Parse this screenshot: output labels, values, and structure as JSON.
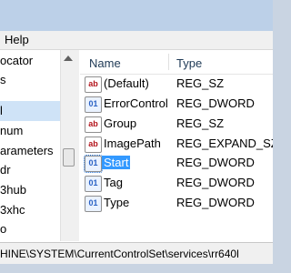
{
  "menu": {
    "help_label": "Help"
  },
  "tree": {
    "items": [
      "ocator",
      "s",
      "",
      "",
      "l",
      "num",
      "arameters",
      "dr",
      "3hub",
      "3xhc",
      "o"
    ]
  },
  "list": {
    "columns": {
      "name": "Name",
      "type": "Type"
    },
    "rows": [
      {
        "name": "(Default)",
        "type": "REG_SZ",
        "icon": "string-value-icon",
        "selected": false
      },
      {
        "name": "ErrorControl",
        "type": "REG_DWORD",
        "icon": "dword-value-icon",
        "selected": false
      },
      {
        "name": "Group",
        "type": "REG_SZ",
        "icon": "string-value-icon",
        "selected": false
      },
      {
        "name": "ImagePath",
        "type": "REG_EXPAND_SZ",
        "icon": "string-value-icon",
        "selected": false
      },
      {
        "name": "Start",
        "type": "REG_DWORD",
        "icon": "dword-value-icon",
        "selected": true
      },
      {
        "name": "Tag",
        "type": "REG_DWORD",
        "icon": "dword-value-icon",
        "selected": false
      },
      {
        "name": "Type",
        "type": "REG_DWORD",
        "icon": "dword-value-icon",
        "selected": false
      }
    ],
    "icon_text": {
      "string": "ab",
      "dword": "01"
    }
  },
  "status": {
    "path": "HINE\\SYSTEM\\CurrentControlSet\\services\\rr640l"
  }
}
